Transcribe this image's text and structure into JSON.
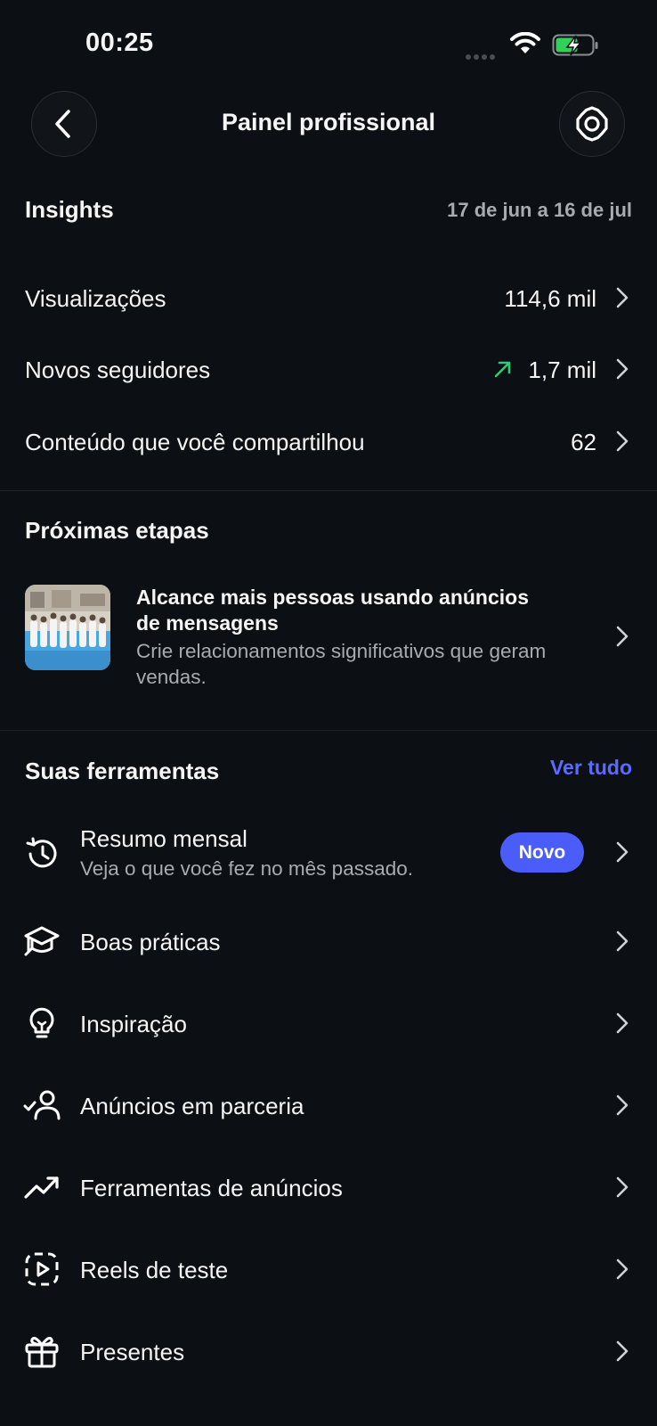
{
  "status_bar": {
    "time": "00:25"
  },
  "header": {
    "title": "Painel profissional"
  },
  "insights": {
    "title": "Insights",
    "date_range": "17 de jun a 16 de jul",
    "rows": [
      {
        "label": "Visualizações",
        "value": "114,6 mil"
      },
      {
        "label": "Novos seguidores",
        "value": "1,7 mil",
        "trend": "up"
      },
      {
        "label": "Conteúdo que você compartilhou",
        "value": "62"
      }
    ]
  },
  "next_steps": {
    "title": "Próximas etapas",
    "item": {
      "title": "Alcance mais pessoas usando anúncios de mensagens",
      "description": "Crie relacionamentos significativos que geram vendas."
    }
  },
  "tools": {
    "title": "Suas ferramentas",
    "see_all": "Ver tudo",
    "items": [
      {
        "label": "Resumo mensal",
        "sub": "Veja o que você fez no mês passado.",
        "badge": "Novo",
        "icon": "history-icon"
      },
      {
        "label": "Boas práticas",
        "icon": "graduation-cap-icon"
      },
      {
        "label": "Inspiração",
        "icon": "lightbulb-icon"
      },
      {
        "label": "Anúncios em parceria",
        "icon": "partner-check-icon"
      },
      {
        "label": "Ferramentas de anúncios",
        "icon": "trending-up-icon"
      },
      {
        "label": "Reels de teste",
        "icon": "reels-test-icon"
      },
      {
        "label": "Presentes",
        "icon": "gift-icon"
      }
    ]
  },
  "colors": {
    "background": "#0c1014",
    "accent": "#4a5df9",
    "link": "#5b6bff",
    "trend_up": "#2ecc71",
    "battery": "#30d158"
  }
}
